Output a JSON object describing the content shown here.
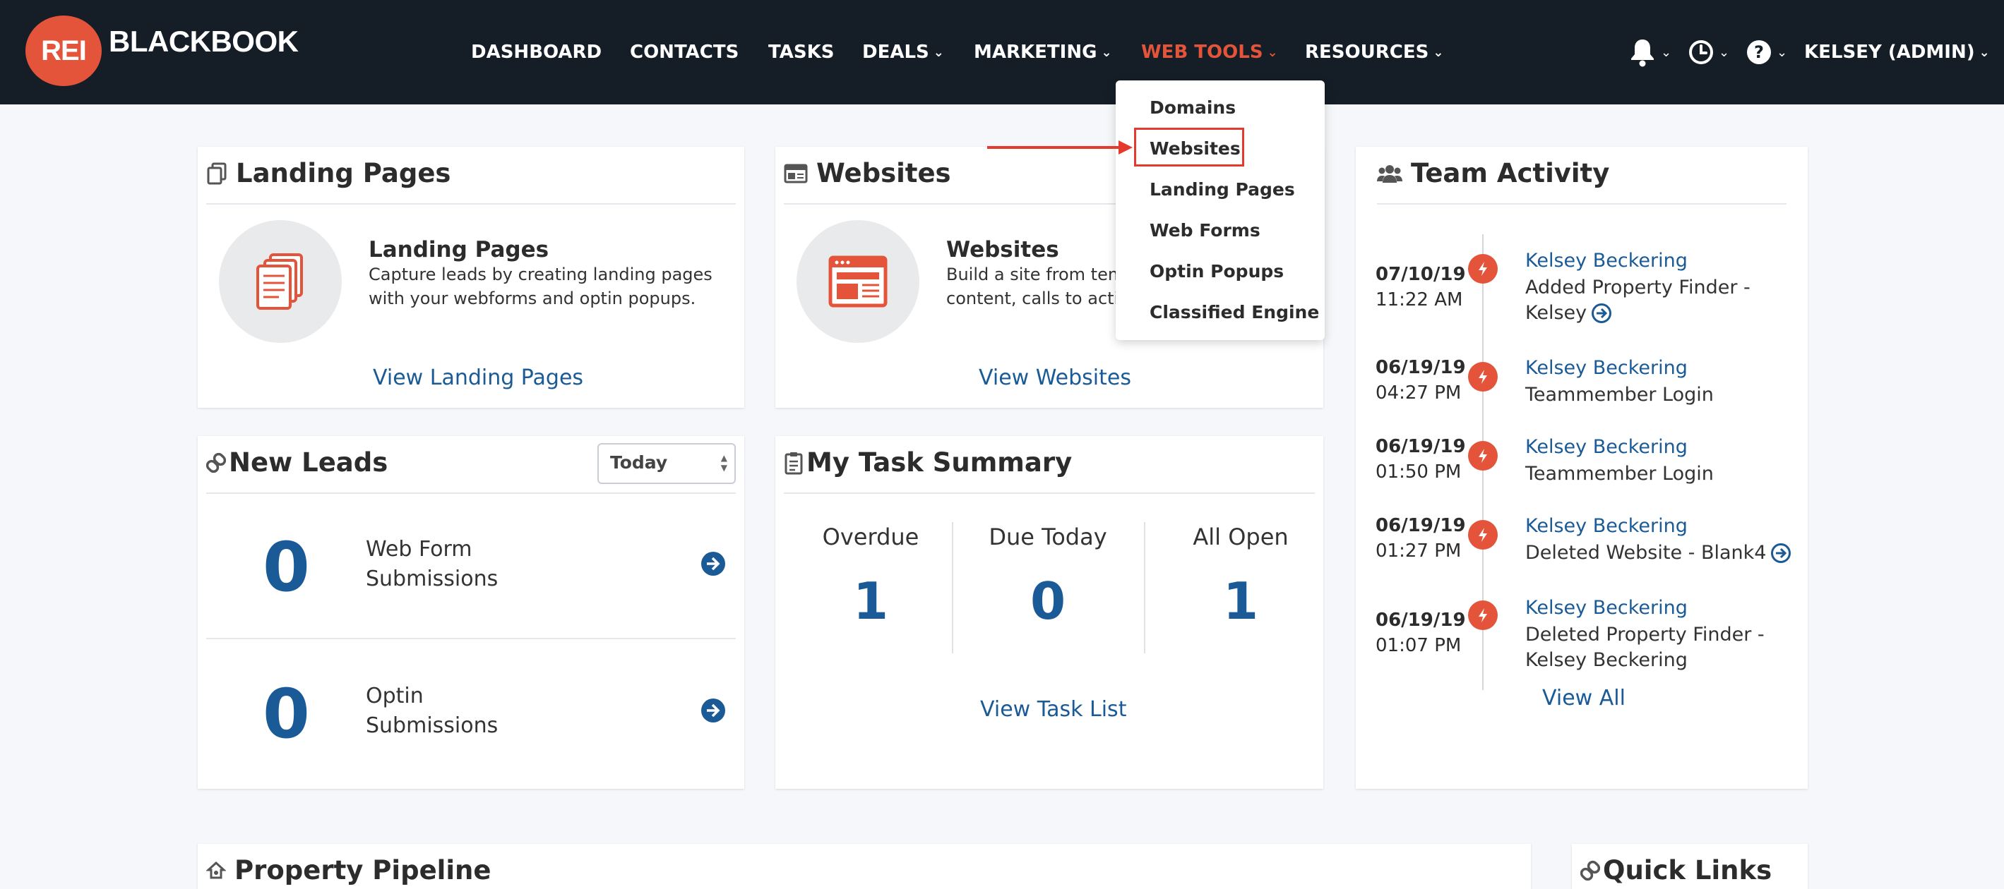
{
  "brand": {
    "logo_short": "REI",
    "logo_text": "BLACKBOOK",
    "accent": "#e4543a",
    "link_color": "#1a5a96",
    "nav_bg": "#151d26"
  },
  "nav": {
    "items": [
      {
        "label": "DASHBOARD"
      },
      {
        "label": "CONTACTS"
      },
      {
        "label": "TASKS"
      },
      {
        "label": "DEALS"
      },
      {
        "label": "MARKETING"
      },
      {
        "label": "WEB TOOLS"
      },
      {
        "label": "RESOURCES"
      }
    ],
    "active": "WEB TOOLS",
    "icons": [
      "bell-icon",
      "clock-icon",
      "help-icon"
    ],
    "user": "KELSEY (ADMIN)"
  },
  "dropdown": {
    "items": [
      "Domains",
      "Websites",
      "Landing Pages",
      "Web Forms",
      "Optin Popups",
      "Classified Engine"
    ],
    "highlighted": "Websites"
  },
  "landing_pages": {
    "title": "Landing Pages",
    "feature_title": "Landing Pages",
    "desc_line1": "Capture leads by creating landing pages",
    "desc_line2": "with your webforms and optin popups.",
    "link": "View Landing Pages"
  },
  "websites": {
    "title": "Websites",
    "feature_title": "Websites",
    "desc_line1": "Build a site from temp",
    "desc_line2": "content, calls to actio",
    "link": "View Websites"
  },
  "new_leads": {
    "title": "New Leads",
    "filter": "Today",
    "rows": [
      {
        "count": "0",
        "label_line1": "Web Form",
        "label_line2": "Submissions"
      },
      {
        "count": "0",
        "label_line1": "Optin",
        "label_line2": "Submissions"
      }
    ]
  },
  "tasks": {
    "title": "My Task Summary",
    "columns": [
      {
        "label": "Overdue",
        "value": "1"
      },
      {
        "label": "Due Today",
        "value": "0"
      },
      {
        "label": "All Open",
        "value": "1"
      }
    ],
    "link": "View Task List"
  },
  "team_activity": {
    "title": "Team Activity",
    "items": [
      {
        "date": "07/10/19",
        "time": "11:22 AM",
        "name": "Kelsey Beckering",
        "line1": "Added Property Finder -",
        "line2": "Kelsey"
      },
      {
        "date": "06/19/19",
        "time": "04:27 PM",
        "name": "Kelsey Beckering",
        "line1": "Teammember Login",
        "line2": ""
      },
      {
        "date": "06/19/19",
        "time": "01:50 PM",
        "name": "Kelsey Beckering",
        "line1": "Teammember Login",
        "line2": ""
      },
      {
        "date": "06/19/19",
        "time": "01:27 PM",
        "name": "Kelsey Beckering",
        "line1": "Deleted Website - Blank4",
        "line2": ""
      },
      {
        "date": "06/19/19",
        "time": "01:07 PM",
        "name": "Kelsey Beckering",
        "line1": "Deleted Property Finder -",
        "line2": "Kelsey Beckering"
      }
    ],
    "link": "View All"
  },
  "property_pipeline": {
    "title": "Property Pipeline"
  },
  "quick_links": {
    "title": "Quick Links"
  }
}
